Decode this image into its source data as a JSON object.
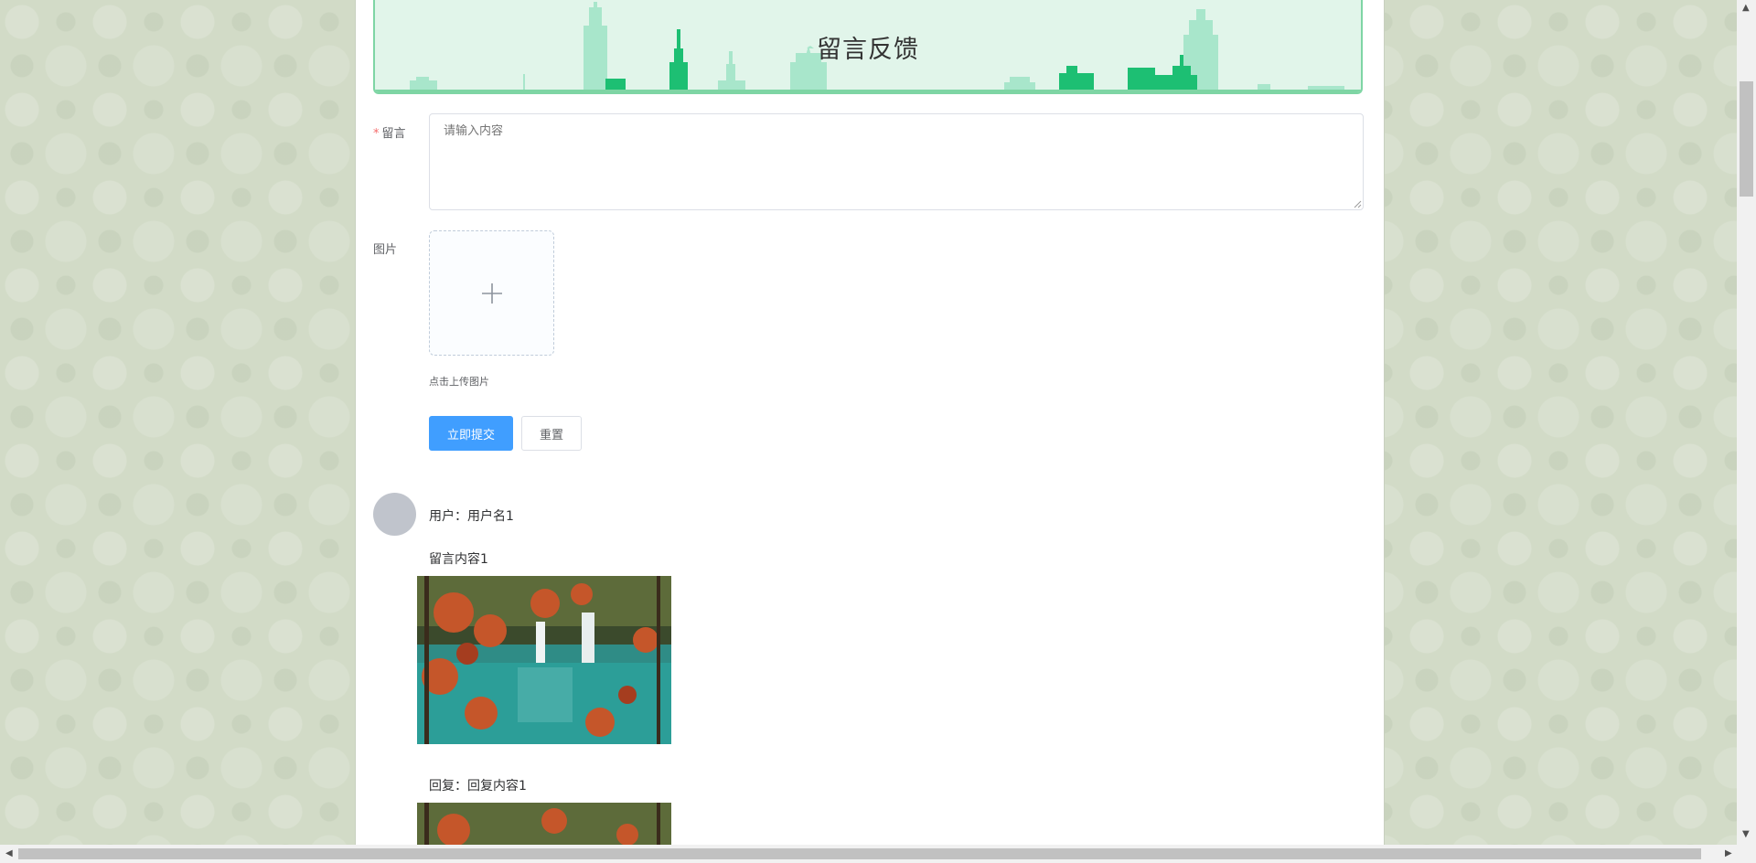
{
  "banner": {
    "title": "留言反馈"
  },
  "form": {
    "message_label": "留言",
    "required_mark": "*",
    "message_placeholder": "请输入内容",
    "image_label": "图片",
    "upload_tip": "点击上传图片",
    "submit_label": "立即提交",
    "reset_label": "重置"
  },
  "comments": [
    {
      "user": "用户：用户名1",
      "content": "留言内容1",
      "reply": "回复：回复内容1"
    }
  ],
  "colors": {
    "primary": "#409eff",
    "banner_bg": "#e1f5ea",
    "banner_border": "#7ed5a4",
    "skyline_dark": "#1dbf73",
    "skyline_light": "#a8e6cb",
    "required": "#f56c6c"
  },
  "icons": {
    "upload": "plus-icon"
  }
}
